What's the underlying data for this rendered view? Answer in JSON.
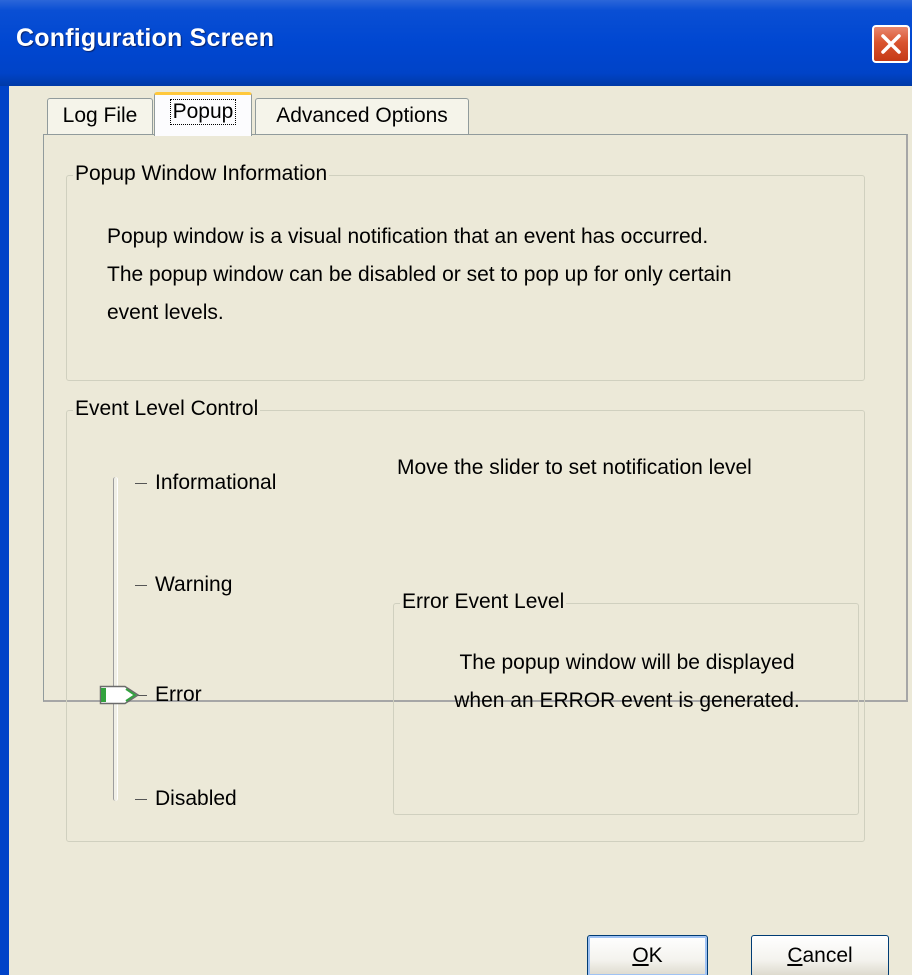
{
  "window": {
    "title": "Configuration Screen",
    "close_icon": "close-icon"
  },
  "tabs": [
    {
      "label": "Log File",
      "active": false
    },
    {
      "label": "Popup",
      "active": true
    },
    {
      "label": "Advanced Options",
      "active": false
    }
  ],
  "popup_info": {
    "legend": "Popup Window Information",
    "description_line1": "Popup window is a visual notification that an event has occurred.",
    "description_line2": "The popup window can be disabled or set to pop up for only certain",
    "description_line3": "event levels."
  },
  "event_level": {
    "legend": "Event Level Control",
    "help_text": "Move the slider to set notification level",
    "levels": [
      "Informational",
      "Warning",
      "Error",
      "Disabled"
    ],
    "selected_level": "Error",
    "selected_index": 2
  },
  "error_event": {
    "legend": "Error Event Level",
    "line1": "The popup window will be displayed",
    "line2": "when an ERROR event is generated."
  },
  "buttons": {
    "ok_mnemonic": "O",
    "ok_rest": "K",
    "cancel_mnemonic": "C",
    "cancel_rest": "ancel"
  },
  "colors": {
    "titlebar": "#0043c8",
    "client": "#ece9d8",
    "tab_highlight": "#ffc83c",
    "close_button": "#d9542f",
    "slider_thumb": "#33a23e"
  }
}
